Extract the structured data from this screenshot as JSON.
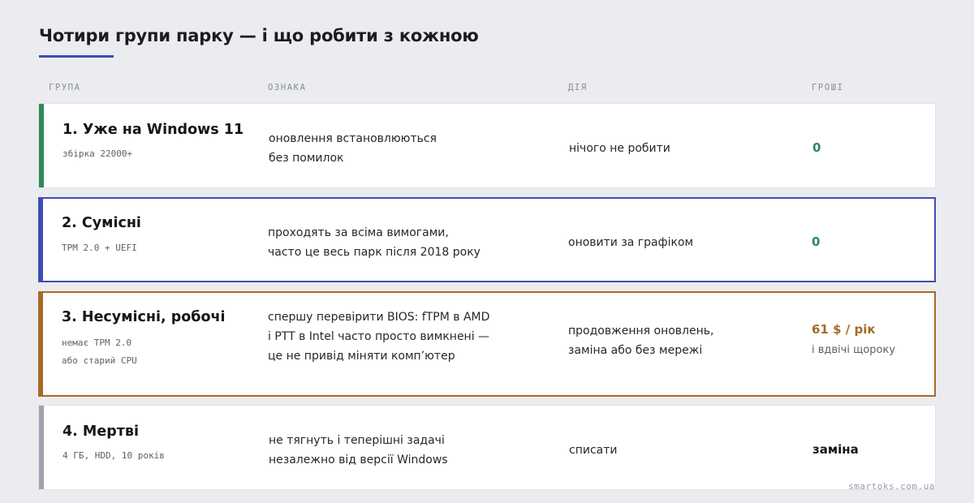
{
  "page": {
    "title": "Чотири групи парку — і що робити з кожною",
    "footer": "smartoks.com.ua"
  },
  "columns": {
    "group": "ГРУПА",
    "sign": "ОЗНАКА",
    "action": "ДІЯ",
    "money": "ГРОШІ"
  },
  "colors": {
    "accent": "#3f4db5",
    "green": "#2e8b57",
    "blue": "#3f4db5",
    "brown": "#a86a23",
    "gray": "#a1a3b0"
  },
  "rows": [
    {
      "name": "1. Уже на Windows 11",
      "sub": [
        "збірка 22000+"
      ],
      "sign": [
        "оновлення встановлюються",
        "без помилок"
      ],
      "action": [
        "нічого не робити"
      ],
      "money": "0",
      "money_note": ""
    },
    {
      "name": "2. Сумісні",
      "sub": [
        "TPM 2.0 + UEFI"
      ],
      "sign": [
        "проходять за всіма вимогами,",
        "часто це весь парк після 2018 року"
      ],
      "action": [
        "оновити за графіком"
      ],
      "money": "0",
      "money_note": ""
    },
    {
      "name": "3. Несумісні, робочі",
      "sub": [
        "немає TPM 2.0",
        "або старий CPU"
      ],
      "sign": [
        "спершу перевірити BIOS: fTPM в AMD",
        "і PTT в Intel часто просто вимкнені —",
        "це не привід міняти комп’ютер"
      ],
      "action": [
        "продовження оновлень,",
        "заміна або без мережі"
      ],
      "money": "61 $ / рік",
      "money_note": "і вдвічі щороку"
    },
    {
      "name": "4. Мертві",
      "sub": [
        "4 ГБ, HDD, 10 років"
      ],
      "sign": [
        "не тягнуть і теперішні задачі",
        "незалежно від версії Windows"
      ],
      "action": [
        "списати"
      ],
      "money": "заміна",
      "money_note": ""
    }
  ]
}
